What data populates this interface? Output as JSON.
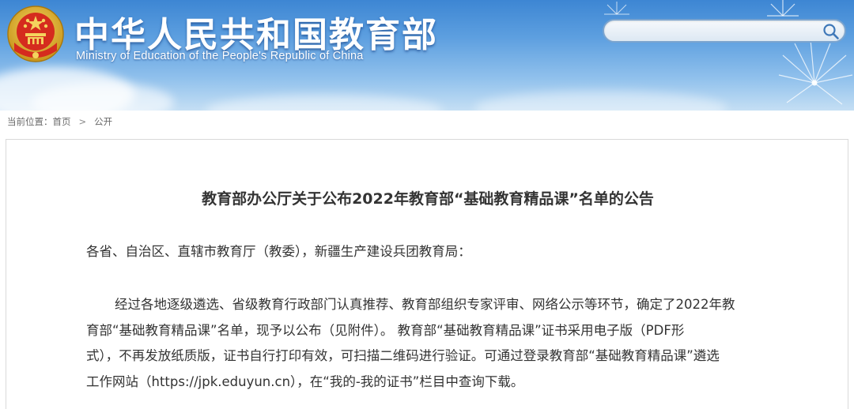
{
  "header": {
    "site_title": "中华人民共和国教育部",
    "site_subtitle": "Ministry of Education of the People's Republic of China",
    "emblem_icon": "national-emblem-icon",
    "colors": {
      "banner_top": "#3d86d3",
      "banner_bottom": "#c5dff4",
      "title_text": "#ffffff"
    }
  },
  "search": {
    "value": "",
    "placeholder": "",
    "icon": "search-icon"
  },
  "breadcrumb": {
    "label": "当前位置：",
    "items": [
      "首页",
      "公开"
    ],
    "separator": ">"
  },
  "article": {
    "title": "教育部办公厅关于公布2022年教育部“基础教育精品课”名单的公告",
    "greeting": "各省、自治区、直辖市教育厅（教委），新疆生产建设兵团教育局：",
    "body_lines": [
      "经过各地逐级遴选、省级教育行政部门认真推荐、教育部组织专家评审、网络公示等环节，确定了2022年教",
      "育部“基础教育精品课”名单，现予以公布（见附件）。 教育部“基础教育精品课”证书采用电子版（PDF形",
      "式），不再发放纸质版，证书自行打印有效，可扫描二维码进行验证。可通过登录教育部“基础教育精品课”遴选",
      "工作网站（https://jpk.eduyun.cn），在“我的-我的证书”栏目中查询下载。"
    ],
    "colors": {
      "text": "#333333",
      "border": "#d9d9d9"
    }
  }
}
